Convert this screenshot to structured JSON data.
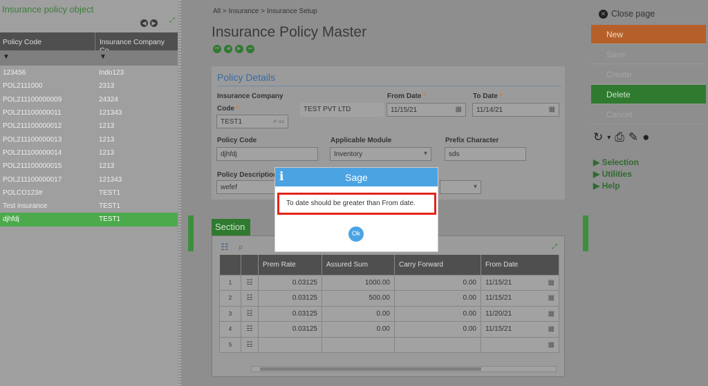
{
  "left_panel": {
    "title": "Insurance policy object",
    "columns": [
      "Policy Code",
      "Insurance Company Co..."
    ],
    "rows": [
      {
        "code": "123456",
        "company": "Indo123"
      },
      {
        "code": "POL2111000",
        "company": "2313"
      },
      {
        "code": "POL211100000009",
        "company": "24324"
      },
      {
        "code": "POL211100000011",
        "company": "121343"
      },
      {
        "code": "POL211100000012",
        "company": "1213"
      },
      {
        "code": "POL211100000013",
        "company": "1213"
      },
      {
        "code": "POL211100000014",
        "company": "1213"
      },
      {
        "code": "POL211100000015",
        "company": "1213"
      },
      {
        "code": "POL211100000017",
        "company": "121343"
      },
      {
        "code": "POLCO123#",
        "company": "TEST1"
      },
      {
        "code": "Test insurance",
        "company": "TEST1"
      },
      {
        "code": "djhfdj",
        "company": "TEST1",
        "selected": true
      }
    ]
  },
  "breadcrumb": {
    "home": "All",
    "sep": ">",
    "level1": "Insurance",
    "level2": "Insurance Setup"
  },
  "page_title": "Insurance Policy Master",
  "policy_details": {
    "legend": "Policy Details",
    "insurance_company_label_1": "Insurance Company",
    "insurance_company_label_2": "Code",
    "insurance_company_code": "TEST1",
    "insurance_company_name": "TEST PVT LTD",
    "from_date_label": "From Date",
    "from_date": "11/15/21",
    "to_date_label": "To Date",
    "to_date": "11/14/21",
    "policy_code_label": "Policy Code",
    "policy_code": "djhfdj",
    "applicable_module_label": "Applicable Module",
    "applicable_module": "Inventory",
    "prefix_label": "Prefix Character",
    "prefix": "sds",
    "description_label": "Policy Description",
    "description": "wefef",
    "required_mark": "*"
  },
  "section": {
    "label": "Section",
    "columns": [
      "Prem Rate",
      "Assured Sum",
      "Carry Forward",
      "From Date"
    ],
    "rows": [
      {
        "n": "1",
        "prem_rate": "0.03125",
        "assured_sum": "1000.00",
        "carry_forward": "0.00",
        "from_date": "11/15/21"
      },
      {
        "n": "2",
        "prem_rate": "0.03125",
        "assured_sum": "500.00",
        "carry_forward": "0.00",
        "from_date": "11/15/21"
      },
      {
        "n": "3",
        "prem_rate": "0.03125",
        "assured_sum": "0.00",
        "carry_forward": "0.00",
        "from_date": "11/20/21"
      },
      {
        "n": "4",
        "prem_rate": "0.03125",
        "assured_sum": "0.00",
        "carry_forward": "0.00",
        "from_date": "11/15/21"
      },
      {
        "n": "5",
        "prem_rate": "",
        "assured_sum": "",
        "carry_forward": "",
        "from_date": ""
      }
    ]
  },
  "right_panel": {
    "close_label": "Close page",
    "actions": {
      "new": "New",
      "save": "Save",
      "create": "Create",
      "delete": "Delete",
      "cancel": "Cancel"
    },
    "menu": {
      "selection": "Selection",
      "utilities": "Utilities",
      "help": "Help"
    }
  },
  "modal": {
    "title": "Sage",
    "message": "To date should be greater than From date.",
    "ok": "Ok"
  },
  "colors": {
    "accent_green": "#2f7a2f",
    "new_orange": "#b5602a",
    "modal_blue": "#4ba3e2",
    "error_red": "#e2231a"
  }
}
